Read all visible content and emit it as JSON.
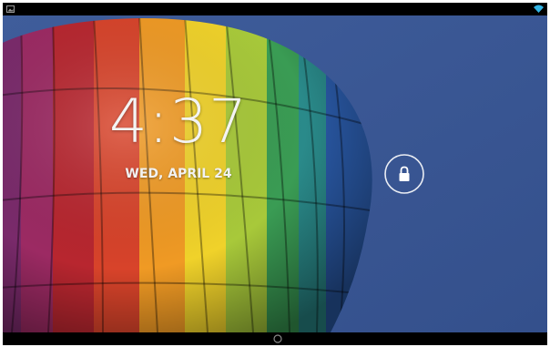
{
  "lockscreen": {
    "time": "4:37",
    "date": "WED, APRIL 24"
  },
  "status_bar": {
    "left_icon": "image-notification-icon",
    "right_icon": "wifi-icon"
  },
  "navigation": {
    "home_icon": "home-button-icon"
  },
  "unlock": {
    "icon": "lock-icon"
  },
  "colors": {
    "background_sky": "#3a5794",
    "status_bar": "#000000",
    "wifi_accent": "#33b5e5",
    "clock_text": "#f4f4f4"
  }
}
